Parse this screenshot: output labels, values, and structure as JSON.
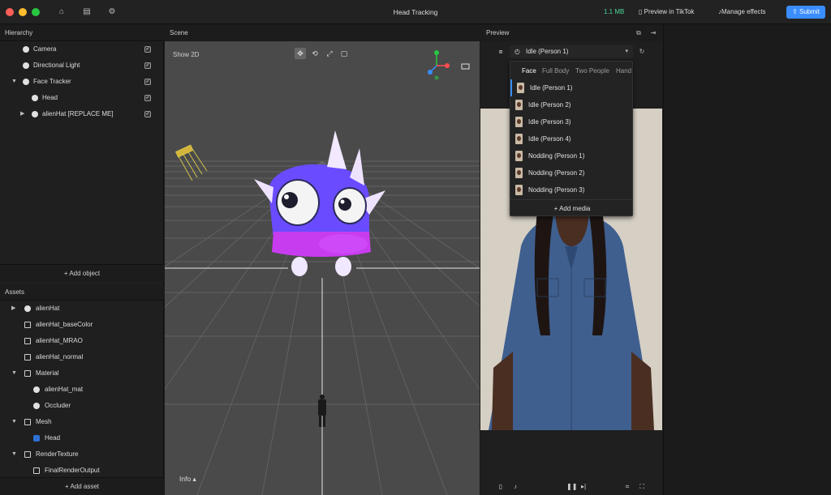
{
  "app": {
    "title": "Head Tracking",
    "file_size": "1.1 MB",
    "preview_in_tiktok": "Preview in TikTok",
    "manage_effects": "Manage effects",
    "submit": "Submit"
  },
  "hierarchy": {
    "title": "Hierarchy",
    "items": [
      {
        "label": "Camera",
        "checked": true
      },
      {
        "label": "Directional Light",
        "checked": true
      },
      {
        "label": "Face Tracker",
        "checked": true
      },
      {
        "label": "Head",
        "checked": true
      },
      {
        "label": "alienHat [REPLACE ME]",
        "checked": true
      }
    ],
    "add_label": "+ Add object"
  },
  "assets": {
    "title": "Assets",
    "items": [
      {
        "label": "alienHat"
      },
      {
        "label": "alienHat_baseColor"
      },
      {
        "label": "alienHat_MRAO"
      },
      {
        "label": "alienHat_normal"
      },
      {
        "label": "Material"
      },
      {
        "label": "alienHat_mat"
      },
      {
        "label": "Occluder"
      },
      {
        "label": "Mesh"
      },
      {
        "label": "Head"
      },
      {
        "label": "RenderTexture"
      },
      {
        "label": "FinalRenderOutput"
      }
    ],
    "add_label": "+ Add asset"
  },
  "scene": {
    "title": "Scene",
    "show2d": "Show 2D",
    "info": "Info ▴"
  },
  "preview": {
    "title": "Preview",
    "selected": "Idle (Person 1)",
    "tabs": [
      "Face",
      "Full Body",
      "Two People",
      "Hand"
    ],
    "items": [
      "Idle (Person 1)",
      "Idle (Person 2)",
      "Idle (Person 3)",
      "Idle (Person 4)",
      "Nodding (Person 1)",
      "Nodding (Person 2)",
      "Nodding (Person 3)"
    ],
    "add_media": "+ Add media"
  },
  "colors": {
    "accent": "#3a8dff",
    "file_size_green": "#48d597",
    "hat_purple": "#6a4bff",
    "hat_band": "#c83cf0"
  }
}
